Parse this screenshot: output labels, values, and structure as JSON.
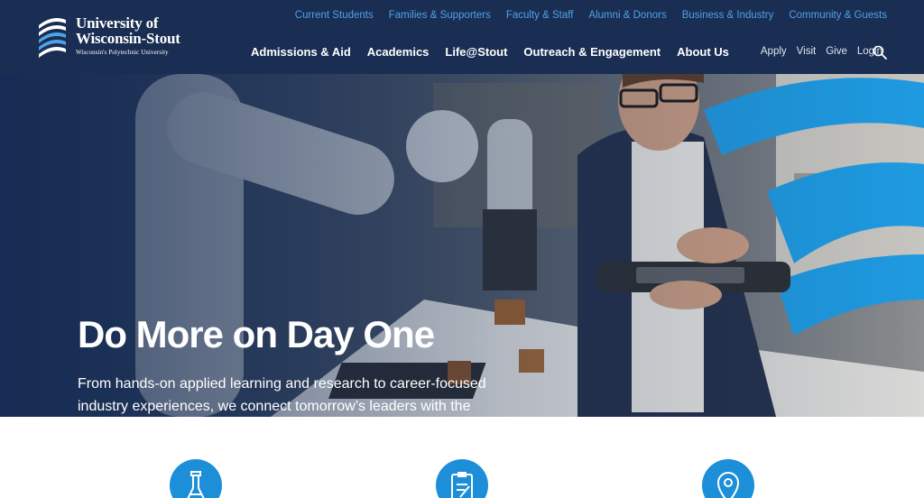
{
  "header": {
    "logo": {
      "line1": "University of",
      "line2": "Wisconsin-Stout",
      "tagline": "Wisconsin's Polytechnic University"
    },
    "audience_links": [
      "Current Students",
      "Families & Supporters",
      "Faculty & Staff",
      "Alumni & Donors",
      "Business & Industry",
      "Community & Guests"
    ],
    "main_nav": [
      "Admissions & Aid",
      "Academics",
      "Life@Stout",
      "Outreach & Engagement",
      "About Us"
    ],
    "utility_nav": [
      "Apply",
      "Visit",
      "Give",
      "Login"
    ],
    "search_icon": "search-icon"
  },
  "hero": {
    "title": "Do More on Day One",
    "body": "From hands-on applied learning and research to career-focused industry experiences, we connect tomorrow’s leaders with the opportunities and employers to shape the future."
  },
  "features": {
    "icons": [
      "flask-icon",
      "clipboard-icon",
      "map-pin-icon"
    ]
  },
  "colors": {
    "header_bg": "#1a2d52",
    "accent_blue": "#4ea3e6",
    "icon_circle": "#1c8fd8"
  }
}
